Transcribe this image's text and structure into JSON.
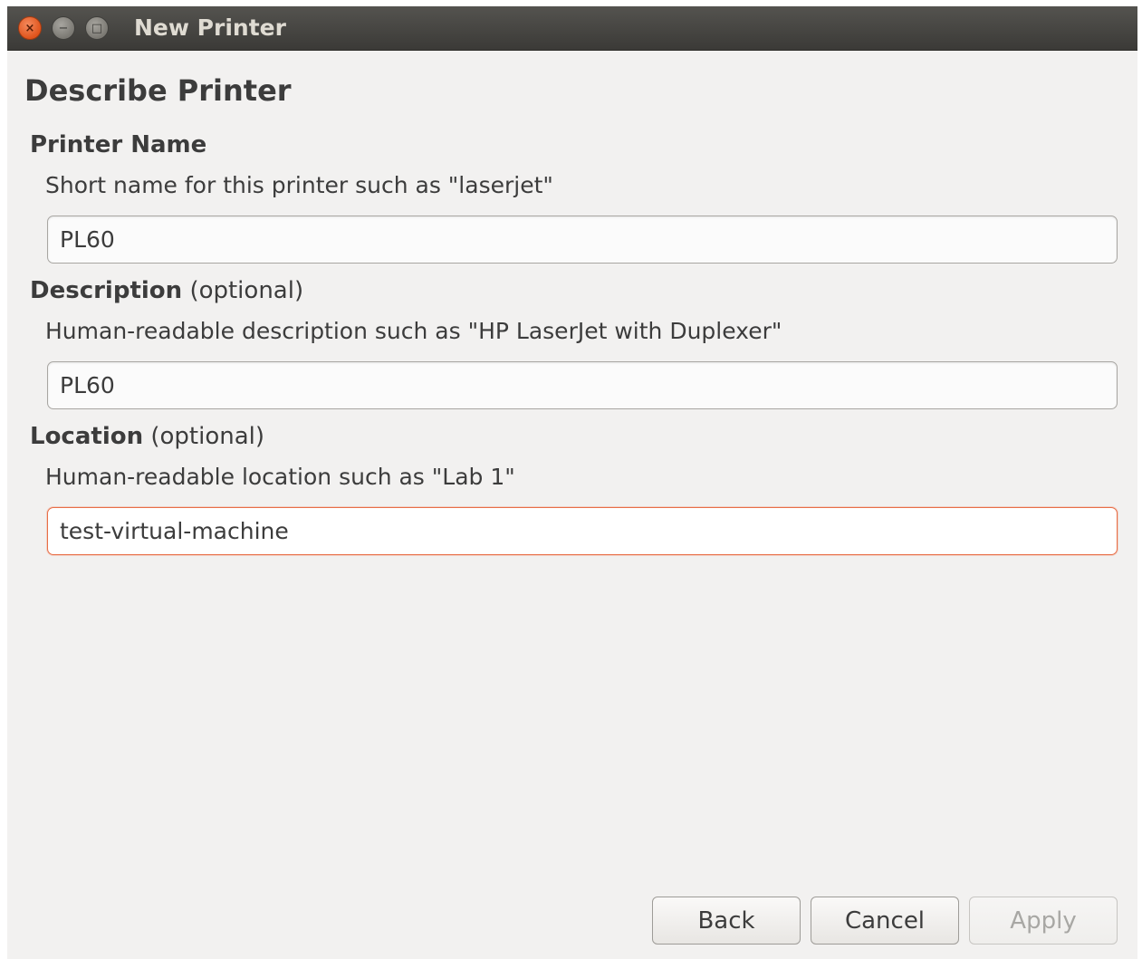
{
  "window": {
    "title": "New Printer",
    "controls": {
      "close_glyph": "×",
      "minimize_glyph": "−",
      "maximize_glyph": "□"
    }
  },
  "page": {
    "title": "Describe Printer"
  },
  "sections": {
    "printer_name": {
      "heading": "Printer Name",
      "hint": "Short name for this printer such as \"laserjet\"",
      "value": "PL60"
    },
    "description": {
      "heading": "Description",
      "optional": "(optional)",
      "hint": "Human-readable description such as \"HP LaserJet with Duplexer\"",
      "value": "PL60"
    },
    "location": {
      "heading": "Location",
      "optional": "(optional)",
      "hint": "Human-readable location such as \"Lab 1\"",
      "value": "test-virtual-machine"
    }
  },
  "buttons": {
    "back": "Back",
    "cancel": "Cancel",
    "apply": "Apply"
  },
  "colors": {
    "titlebar": "#3c3b37",
    "close_button": "#e95420",
    "focus_border": "#e86e47",
    "window_bg": "#f2f1f0"
  }
}
